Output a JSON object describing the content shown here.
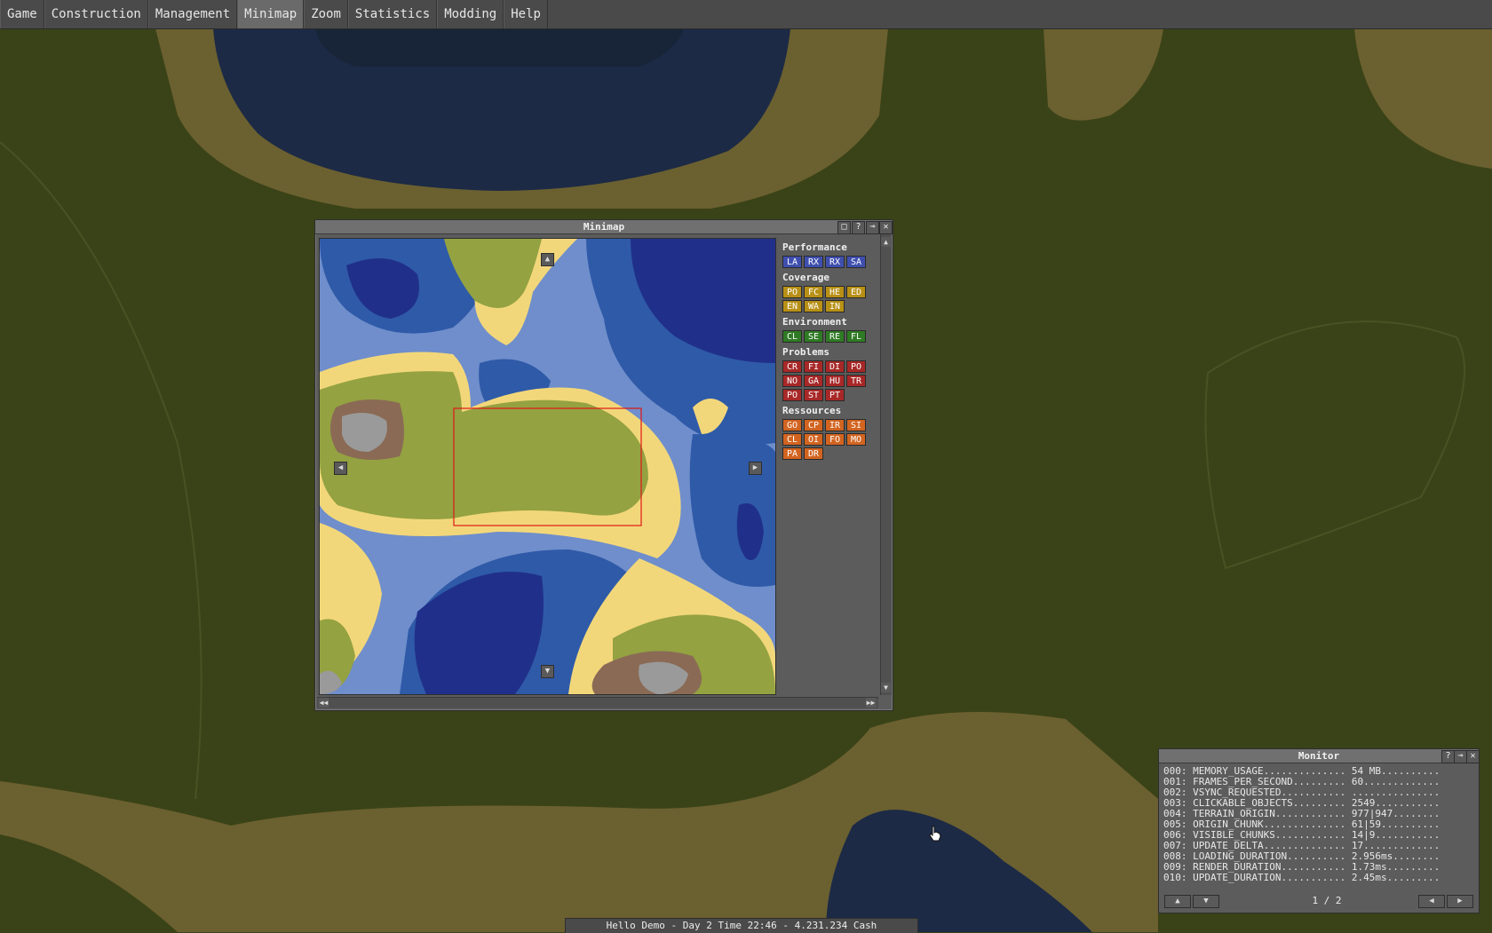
{
  "menu": {
    "items": [
      {
        "label": "Game",
        "active": false
      },
      {
        "label": "Construction",
        "active": false
      },
      {
        "label": "Management",
        "active": false
      },
      {
        "label": "Minimap",
        "active": true
      },
      {
        "label": "Zoom",
        "active": false
      },
      {
        "label": "Statistics",
        "active": false
      },
      {
        "label": "Modding",
        "active": false
      },
      {
        "label": "Help",
        "active": false
      }
    ]
  },
  "minimap": {
    "title": "Minimap",
    "title_buttons": [
      "maximize-icon",
      "help-icon",
      "pin-icon",
      "close-icon"
    ],
    "groups": [
      {
        "title": "Performance",
        "color": "#3f4fae",
        "class": "c-perf",
        "buttons": [
          "LA",
          "RX",
          "RX",
          "SA"
        ]
      },
      {
        "title": "Coverage",
        "color": "#b89016",
        "class": "c-cov",
        "buttons": [
          "PO",
          "FC",
          "HE",
          "ED",
          "EN",
          "WA",
          "IN"
        ]
      },
      {
        "title": "Environment",
        "color": "#2f7a24",
        "class": "c-env",
        "buttons": [
          "CL",
          "SE",
          "RE",
          "FL"
        ]
      },
      {
        "title": "Problems",
        "color": "#a82828",
        "class": "c-prob",
        "buttons": [
          "CR",
          "FI",
          "DI",
          "PO",
          "NO",
          "GA",
          "HU",
          "TR",
          "PO",
          "ST",
          "PT"
        ]
      },
      {
        "title": "Ressources",
        "color": "#d26420",
        "class": "c-res",
        "buttons": [
          "GO",
          "CP",
          "IR",
          "SI",
          "CL",
          "OI",
          "FO",
          "MO",
          "PA",
          "DR"
        ]
      }
    ]
  },
  "monitor": {
    "title": "Monitor",
    "rows": [
      "000: MEMORY_USAGE.............. 54 MB..........",
      "001: FRAMES_PER_SECOND......... 60.............",
      "002: VSYNC_REQUESTED........... ...............",
      "003: CLICKABLE_OBJECTS......... 2549...........",
      "004: TERRAIN_ORIGIN............ 977|947........",
      "005: ORIGIN_CHUNK.............. 61|59..........",
      "006: VISIBLE_CHUNKS............ 14|9...........",
      "007: UPDATE_DELTA.............. 17.............",
      "008: LOADING_DURATION.......... 2.956ms........",
      "009: RENDER_DURATION........... 1.73ms.........",
      "010: UPDATE_DURATION........... 2.45ms........."
    ],
    "page": "1 / 2"
  },
  "status": {
    "text": "Hello Demo - Day 2 Time 22:46 - 4.231.234 Cash"
  },
  "colors": {
    "grass": "#3a4317",
    "sand": "#6b6030",
    "water_deep": "#1c2a45",
    "mm_grass": "#94a241",
    "mm_sand": "#f2d77a",
    "mm_shallow": "#6f8ecb",
    "mm_mid": "#2f5aa8",
    "mm_deep": "#20308a",
    "mm_mountain": "#8a6a55",
    "mm_rock": "#9a9a9a"
  }
}
